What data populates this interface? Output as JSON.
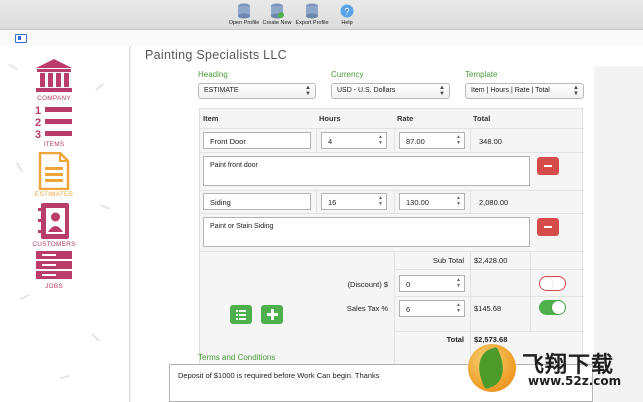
{
  "toolbar": {
    "open_profile": "Open Profile",
    "create_new": "Create New",
    "export_profile": "Export Profile",
    "help": "Help"
  },
  "sidebar": {
    "items": [
      {
        "label": "COMPANY",
        "icon": "bank-icon",
        "color": "#b93c6b"
      },
      {
        "label": "ITEMS",
        "icon": "numbered-list-icon",
        "color": "#b93c6b"
      },
      {
        "label": "ESTIMATES",
        "icon": "document-icon",
        "color": "#f0a53a"
      },
      {
        "label": "CUSTOMERS",
        "icon": "contacts-book-icon",
        "color": "#b93c6b"
      },
      {
        "label": "JOBS",
        "icon": "jobs-stack-icon",
        "color": "#b93c6b"
      }
    ],
    "label_color": "#4a9b3a"
  },
  "main": {
    "company_name": "Painting Specialists LLC",
    "heading_label": "Heading",
    "heading_value": "ESTIMATE",
    "currency_label": "Currency",
    "currency_value": "USD - U.S. Dollars",
    "template_label": "Template",
    "template_value": "Item | Hours | Rate | Total",
    "columns": [
      "Item",
      "Hours",
      "Rate",
      "Total"
    ],
    "rows": [
      {
        "item": "Front Door",
        "hours": "4",
        "rate": "87.00",
        "total": "348.00",
        "description": "Paint front door"
      },
      {
        "item": "Siding",
        "hours": "16",
        "rate": "130.00",
        "total": "2,080.00",
        "description": "Paint or Stain Siding"
      }
    ],
    "subtotal_label": "Sub Total",
    "subtotal_value": "$2,428.00",
    "discount_label": "(Discount) $",
    "discount_value": "0",
    "tax_label": "Sales Tax %",
    "tax_value": "6",
    "tax_amount": "$145.68",
    "total_label": "Total",
    "total_value": "$2,573.68",
    "terms_label": "Terms and Conditions",
    "terms_text": "Deposit of $1000 is required before Work Can begin. Thanks",
    "discount_toggle_on": false,
    "tax_toggle_on": true
  },
  "watermark": {
    "cn_text": "飞翔下载",
    "url": "www.52z.com"
  },
  "colors": {
    "accent_green": "#4a9b3a",
    "brand_maroon": "#b93c6b",
    "danger_red": "#d84b4b",
    "toggle_green": "#4db04c"
  }
}
